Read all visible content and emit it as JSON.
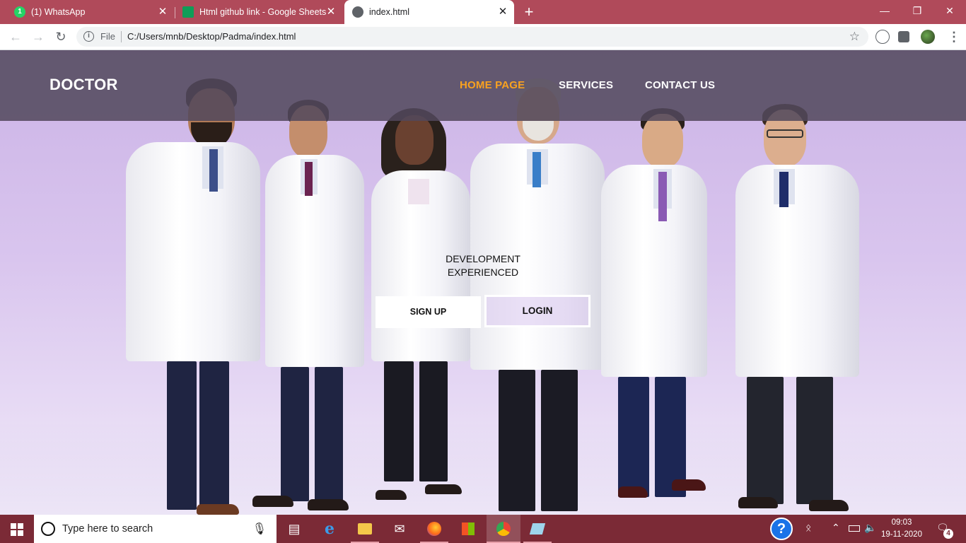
{
  "browser": {
    "tabs": [
      {
        "title": "(1) WhatsApp",
        "favicon": "whatsapp-icon",
        "favicon_badge": "1",
        "active": false
      },
      {
        "title": "Html github link - Google Sheets",
        "favicon": "google-sheets-icon",
        "active": false
      },
      {
        "title": "index.html",
        "favicon": "globe-icon",
        "active": true
      }
    ],
    "tab_close_glyph": "✕",
    "new_tab_glyph": "+",
    "window_controls": {
      "minimize": "—",
      "maximize": "❐",
      "close": "✕"
    },
    "address": {
      "scheme_label": "File",
      "url": "C:/Users/mnb/Desktop/Padma/index.html"
    },
    "colors": {
      "tabstrip": "#b04a5a",
      "toolbar": "#ffffff"
    }
  },
  "site": {
    "brand": "DOCTOR",
    "nav": [
      {
        "label": "HOME PAGE",
        "active": true
      },
      {
        "label": "SERVICES",
        "active": false
      },
      {
        "label": "CONTACT US",
        "active": false
      }
    ],
    "hero_lines": [
      "DEVELOPMENT",
      "EXPERIENCED"
    ],
    "signup_label": "SIGN UP",
    "login_label": "LOGIN",
    "colors": {
      "nav_bg": "#52485c",
      "active_link": "#f9a21f",
      "hero_bg": "#d9c5ee"
    }
  },
  "taskbar": {
    "search_placeholder": "Type here to search",
    "apps": [
      "task-view-icon",
      "edge-icon",
      "file-explorer-icon",
      "mail-icon",
      "firefox-icon",
      "store-icon",
      "chrome-icon",
      "notepad-icon"
    ],
    "time": "09:03",
    "date": "19-11-2020",
    "notification_count": "4",
    "colors": {
      "bar": "#7b2a36"
    }
  }
}
